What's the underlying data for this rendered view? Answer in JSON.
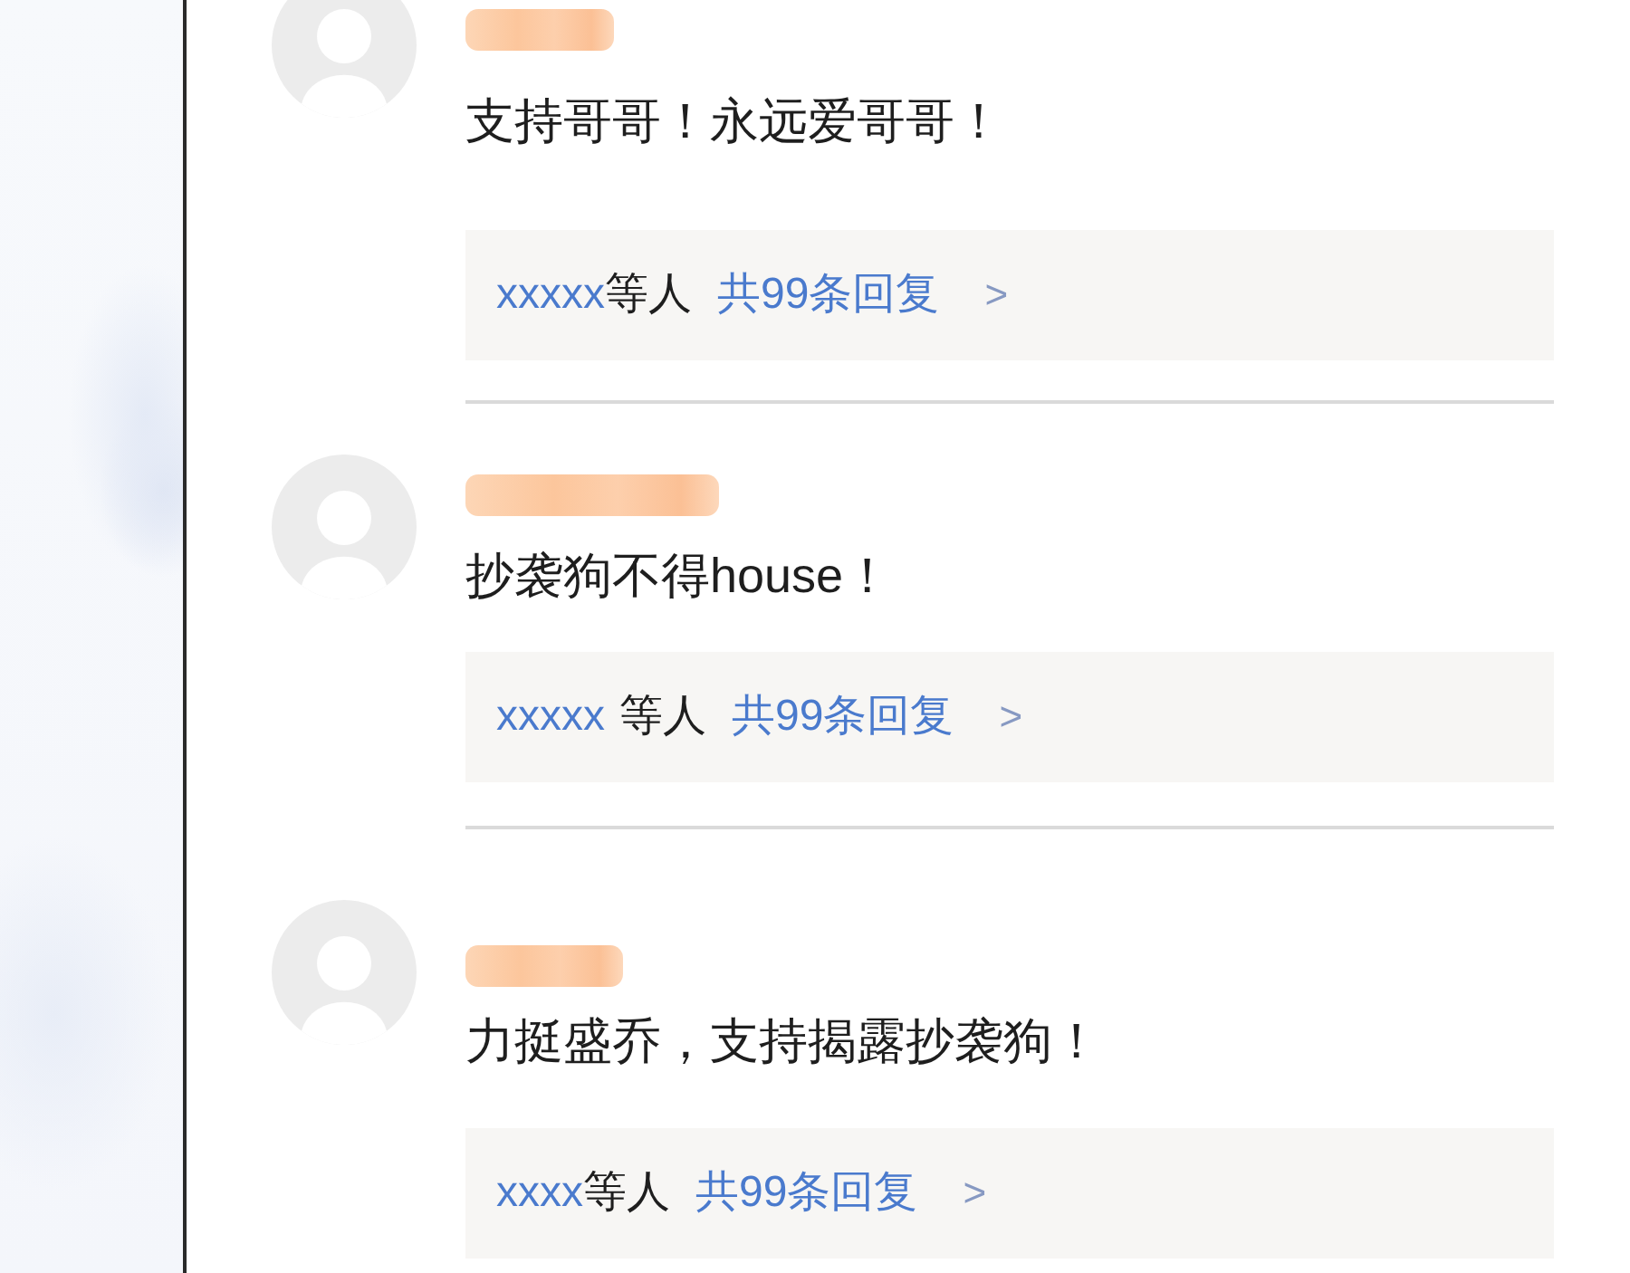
{
  "comments": [
    {
      "text": "支持哥哥！永远爱哥哥！",
      "replies": {
        "users": "xxxxx",
        "suffix": "等人",
        "count": "共99条回复",
        "arrow": ">"
      }
    },
    {
      "text": "抄袭狗不得house！",
      "replies": {
        "users": "xxxxx",
        "suffix": "等人",
        "count": "共99条回复",
        "arrow": ">"
      }
    },
    {
      "text": "力挺盛乔，支持揭露抄袭狗！",
      "replies": {
        "users": "xxxx",
        "suffix": "等人",
        "count": "共99条回复",
        "arrow": ">"
      }
    }
  ]
}
